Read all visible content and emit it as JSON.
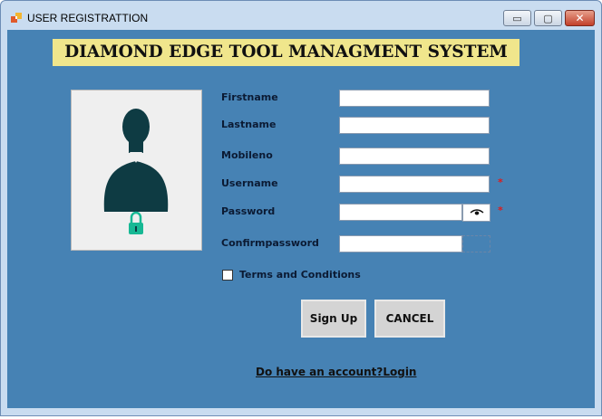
{
  "window": {
    "title": "USER REGISTRATTION",
    "controls": {
      "minimize": "▭",
      "maximize": "▢",
      "close": "✕"
    }
  },
  "heading": "DIAMOND EDGE TOOL MANAGMENT SYSTEM",
  "avatar": {
    "icon": "user-lock-icon"
  },
  "form": {
    "firstname": {
      "label": "Firstname",
      "value": ""
    },
    "lastname": {
      "label": "Lastname",
      "value": ""
    },
    "mobileno": {
      "label": "Mobileno",
      "value": ""
    },
    "username": {
      "label": "Username",
      "value": "",
      "required_mark": "*"
    },
    "password": {
      "label": "Password",
      "value": "",
      "required_mark": "*",
      "toggle_icon": "eye-icon"
    },
    "confirmpassword": {
      "label": "Confirmpassword",
      "value": ""
    }
  },
  "terms": {
    "label": "Terms and Conditions",
    "checked": false
  },
  "buttons": {
    "signup": "Sign Up",
    "cancel": "CANCEL"
  },
  "login_link": "Do have an account?Login",
  "colors": {
    "client_bg": "#4682b4",
    "heading_bg": "#f0e68c",
    "avatar_bg": "#efefef",
    "silhouette": "#0e3b43",
    "lock": "#17b894",
    "required": "#e01a1a",
    "button_bg": "#d4d4d4"
  }
}
